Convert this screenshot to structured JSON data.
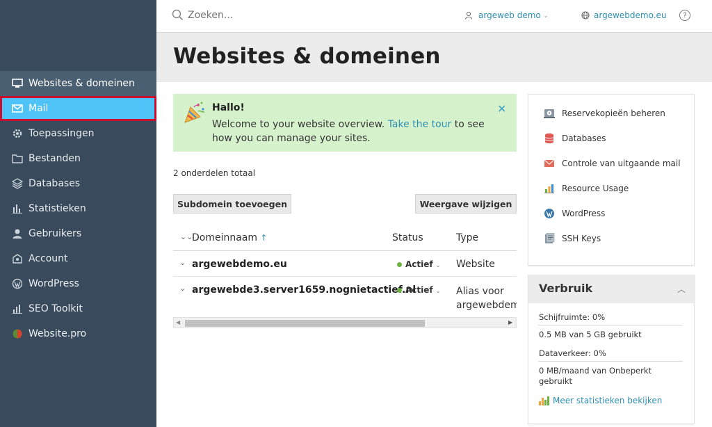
{
  "sidebar": {
    "items": [
      {
        "label": "Websites & domeinen",
        "icon": "monitor-icon",
        "state": "active"
      },
      {
        "label": "Mail",
        "icon": "mail-icon",
        "state": "selected"
      },
      {
        "label": "Toepassingen",
        "icon": "gear-icon"
      },
      {
        "label": "Bestanden",
        "icon": "folder-icon"
      },
      {
        "label": "Databases",
        "icon": "layers-icon"
      },
      {
        "label": "Statistieken",
        "icon": "bar-chart-icon"
      },
      {
        "label": "Gebruikers",
        "icon": "user-icon"
      },
      {
        "label": "Account",
        "icon": "account-icon"
      },
      {
        "label": "WordPress",
        "icon": "wordpress-icon"
      },
      {
        "label": "SEO Toolkit",
        "icon": "seo-chart-icon"
      },
      {
        "label": "Website.pro",
        "icon": "website-pro-icon"
      }
    ]
  },
  "topbar": {
    "search_placeholder": "Zoeken...",
    "user": "argeweb demo",
    "domain": "argewebdemo.eu",
    "help": "?"
  },
  "page": {
    "title": "Websites & domeinen"
  },
  "banner": {
    "title": "Hallo!",
    "text_before": "Welcome to your website overview. ",
    "link": "Take the tour",
    "text_after": " to see how you can manage your sites.",
    "close": "✕"
  },
  "summary": {
    "total": "2 onderdelen totaal"
  },
  "toolbar": {
    "add_subdomain": "Subdomein toevoegen",
    "change_view": "Weergave wijzigen"
  },
  "table": {
    "headers": {
      "name": "Domeinnaam",
      "sort": "↑",
      "status": "Status",
      "type": "Type"
    },
    "rows": [
      {
        "name": "argewebdemo.eu",
        "status": "Actief",
        "type_line1": "Website",
        "type_line2": ""
      },
      {
        "name": "argewebde3.server1659.nognietactief.nl",
        "status": "Actief",
        "type_line1": "Alias voor",
        "type_line2": "argewebdemo"
      }
    ]
  },
  "tools": {
    "items": [
      {
        "label": "Reservekopieën beheren",
        "icon": "backup-icon"
      },
      {
        "label": "Databases",
        "icon": "database-icon"
      },
      {
        "label": "Controle van uitgaande mail",
        "icon": "envelope-icon"
      },
      {
        "label": "Resource Usage",
        "icon": "resource-chart-icon"
      },
      {
        "label": "WordPress",
        "icon": "wordpress-icon"
      },
      {
        "label": "SSH Keys",
        "icon": "ssh-key-icon"
      }
    ]
  },
  "usage": {
    "title": "Verbruik",
    "disk_label": "Schijfruimte: 0%",
    "disk_value": "0.5 MB van 5 GB gebruikt",
    "traffic_label": "Dataverkeer: 0%",
    "traffic_value_line1": "0 MB/maand van Onbeperkt",
    "traffic_value_line2": "gebruikt",
    "more_link": "Meer statistieken bekijken"
  },
  "colors": {
    "sidebar": "#384a5b",
    "selected": "#4fc3f7",
    "accent": "#2f8fb2",
    "banner": "#d5f2cc",
    "status_active": "#6cb33f",
    "highlight_border": "#c8102e"
  }
}
